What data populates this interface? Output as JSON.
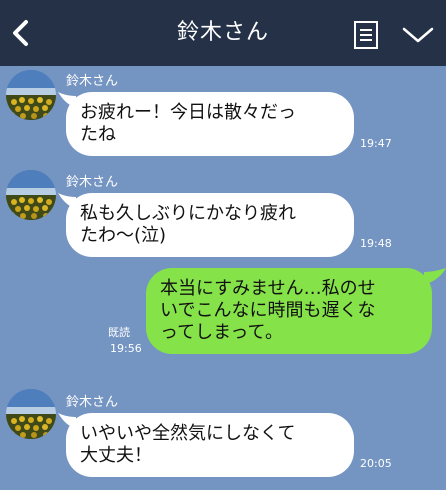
{
  "header": {
    "title": "鈴木さん",
    "back_icon": "chevron-left-icon",
    "notes_icon": "notes-icon",
    "menu_icon": "chevron-down-icon",
    "background": "#253147"
  },
  "chat": {
    "background": "#7494c2",
    "incoming_bubble_color": "#ffffff",
    "outgoing_bubble_color": "#85e249",
    "messages": [
      {
        "sender": "鈴木さん",
        "text": "お疲れー！今日は散々だっ\nたね",
        "time": "19:47"
      },
      {
        "sender": "鈴木さん",
        "text": "私も久しぶりにかなり疲れ\nたわ〜(泣)",
        "time": "19:48"
      },
      {
        "text": "本当にすみません…私のせ\nいでこんなに時間も遅くな\nってしまって。",
        "read": "既読",
        "time": "19:56"
      },
      {
        "sender": "鈴木さん",
        "text": "いやいや全然気にしなくて\n大丈夫！",
        "time": "20:05"
      }
    ]
  }
}
